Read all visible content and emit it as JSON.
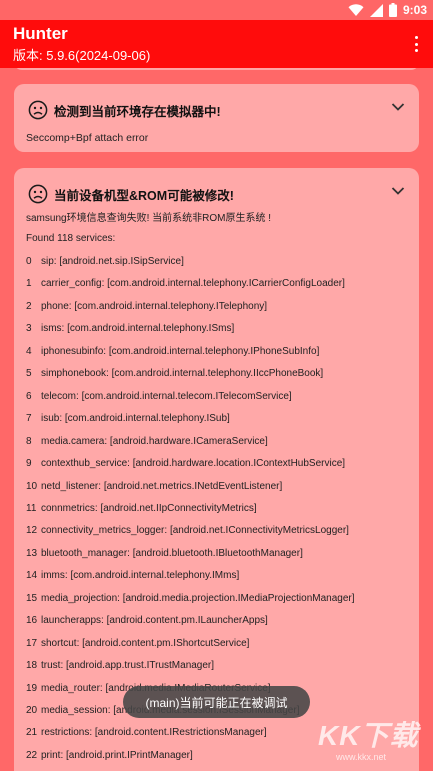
{
  "status_bar": {
    "time": "9:03",
    "icons": [
      "wifi-icon",
      "signal-icon",
      "battery-icon"
    ]
  },
  "app_bar": {
    "title": "Hunter",
    "version": "版本: 5.9.6(2024-09-06)",
    "menu_icon": "overflow-menu-icon"
  },
  "colors": {
    "app_bar": "#ff0c0c",
    "background": "#ff6868",
    "card": "#ffa8a8"
  },
  "cards": [
    {
      "title": "检测到当前环境存在模拟器中!",
      "body": "Seccomp+Bpf attach error"
    },
    {
      "title": "当前设备机型&ROM可能被修改!",
      "lines": [
        "samsung环境信息查询失败! 当前系统非ROM原生系统 !",
        "Found 118 services:"
      ],
      "services": [
        {
          "num": "0",
          "text": "sip: [android.net.sip.ISipService]"
        },
        {
          "num": "1",
          "text": "carrier_config: [com.android.internal.telephony.ICarrierConfigLoader]"
        },
        {
          "num": "2",
          "text": "phone: [com.android.internal.telephony.ITelephony]"
        },
        {
          "num": "3",
          "text": "isms: [com.android.internal.telephony.ISms]"
        },
        {
          "num": "4",
          "text": "iphonesubinfo: [com.android.internal.telephony.IPhoneSubInfo]"
        },
        {
          "num": "5",
          "text": "simphonebook: [com.android.internal.telephony.IIccPhoneBook]"
        },
        {
          "num": "6",
          "text": "telecom: [com.android.internal.telecom.ITelecomService]"
        },
        {
          "num": "7",
          "text": "isub: [com.android.internal.telephony.ISub]"
        },
        {
          "num": "8",
          "text": "media.camera: [android.hardware.ICameraService]"
        },
        {
          "num": "9",
          "text": "contexthub_service: [android.hardware.location.IContextHubService]"
        },
        {
          "num": "10",
          "text": "netd_listener: [android.net.metrics.INetdEventListener]"
        },
        {
          "num": "11",
          "text": "connmetrics: [android.net.IIpConnectivityMetrics]"
        },
        {
          "num": "12",
          "text": "connectivity_metrics_logger: [android.net.IConnectivityMetricsLogger]"
        },
        {
          "num": "13",
          "text": "bluetooth_manager: [android.bluetooth.IBluetoothManager]"
        },
        {
          "num": "14",
          "text": "imms: [com.android.internal.telephony.IMms]"
        },
        {
          "num": "15",
          "text": "media_projection: [android.media.projection.IMediaProjectionManager]"
        },
        {
          "num": "16",
          "text": "launcherapps: [android.content.pm.ILauncherApps]"
        },
        {
          "num": "17",
          "text": "shortcut: [android.content.pm.IShortcutService]"
        },
        {
          "num": "18",
          "text": "trust: [android.app.trust.ITrustManager]"
        },
        {
          "num": "19",
          "text": "media_router: [android.media.IMediaRouterService]"
        },
        {
          "num": "20",
          "text": "media_session: [android.media.session.ISessionManager]"
        },
        {
          "num": "21",
          "text": "restrictions: [android.content.IRestrictionsManager]"
        },
        {
          "num": "22",
          "text": "print: [android.print.IPrintManager]"
        }
      ]
    }
  ],
  "toast": "(main)当前可能正在被调试",
  "watermark": {
    "text": "KK下载",
    "url": "www.kkx.net"
  }
}
